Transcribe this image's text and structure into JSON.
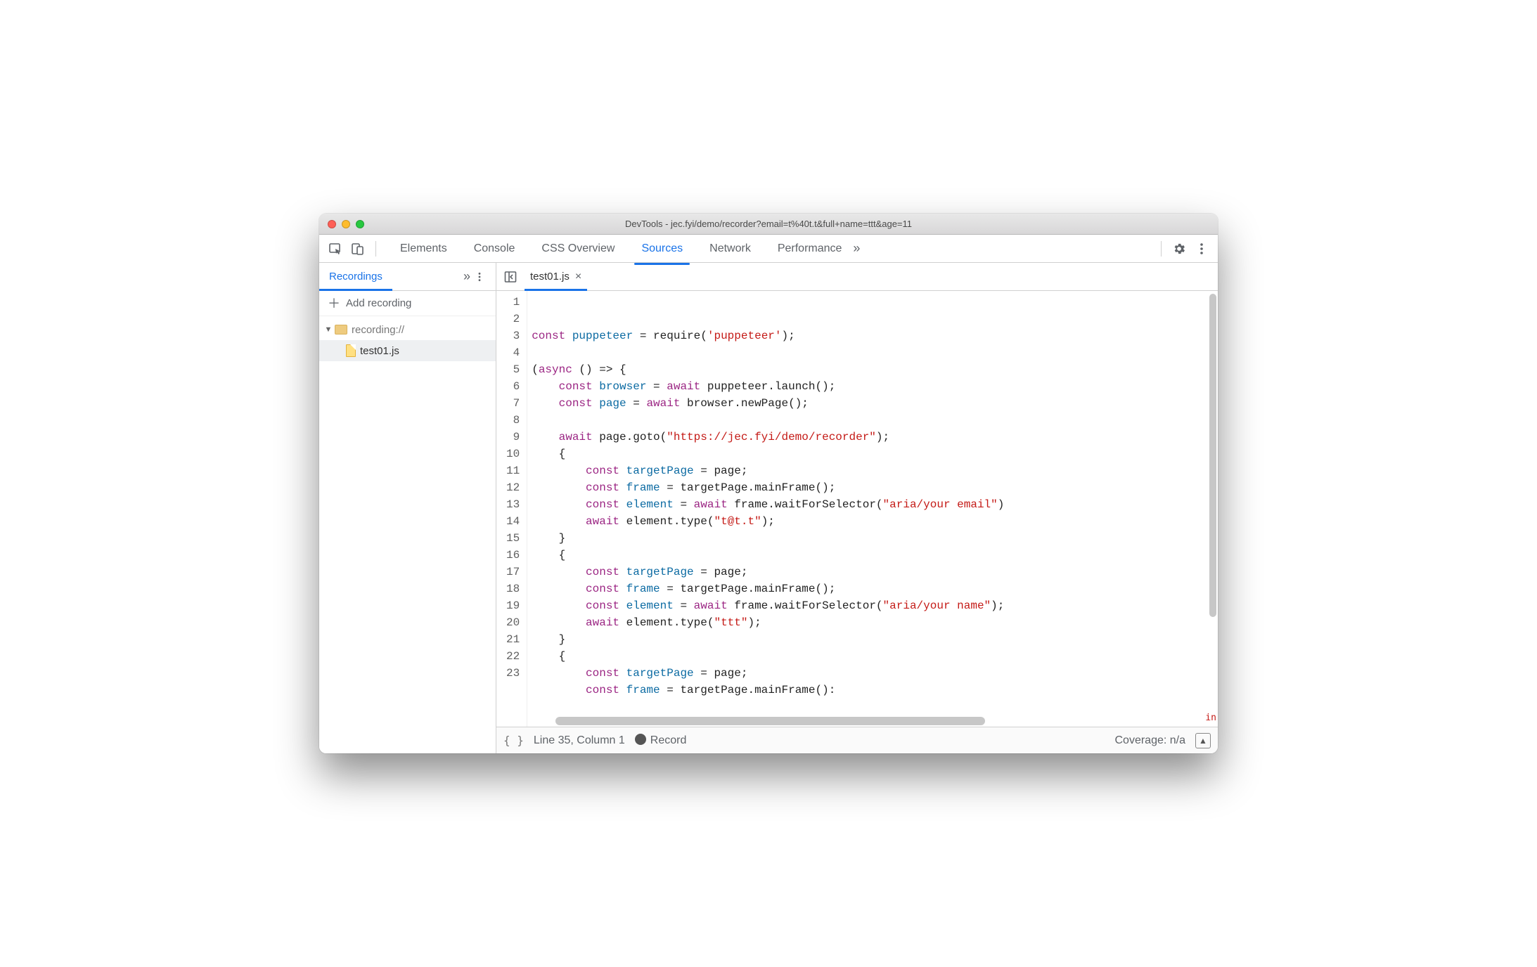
{
  "window": {
    "title": "DevTools - jec.fyi/demo/recorder?email=t%40t.t&full+name=ttt&age=11"
  },
  "main_tabs": {
    "items": [
      "Elements",
      "Console",
      "CSS Overview",
      "Sources",
      "Network",
      "Performance"
    ],
    "active_index": 3
  },
  "sidebar": {
    "tab_label": "Recordings",
    "add_label": "Add recording",
    "tree": {
      "root_label": "recording://",
      "file_label": "test01.js"
    }
  },
  "editor": {
    "tab_label": "test01.js",
    "gutter_start": 1,
    "gutter_end": 23,
    "truncated_hint": "in",
    "lines": [
      [
        {
          "t": "const ",
          "c": "kw"
        },
        {
          "t": "puppeteer",
          "c": "id"
        },
        {
          "t": " = ",
          "c": "pun"
        },
        {
          "t": "require",
          "c": "prop"
        },
        {
          "t": "(",
          "c": "pun"
        },
        {
          "t": "'puppeteer'",
          "c": "str"
        },
        {
          "t": ");",
          "c": "pun"
        }
      ],
      [],
      [
        {
          "t": "(",
          "c": "pun"
        },
        {
          "t": "async ",
          "c": "kw"
        },
        {
          "t": "() => {",
          "c": "pun"
        }
      ],
      [
        {
          "t": "    ",
          "c": "pun"
        },
        {
          "t": "const ",
          "c": "kw"
        },
        {
          "t": "browser",
          "c": "id"
        },
        {
          "t": " = ",
          "c": "pun"
        },
        {
          "t": "await ",
          "c": "kw"
        },
        {
          "t": "puppeteer",
          "c": "prop"
        },
        {
          "t": ".",
          "c": "pun"
        },
        {
          "t": "launch",
          "c": "prop"
        },
        {
          "t": "();",
          "c": "pun"
        }
      ],
      [
        {
          "t": "    ",
          "c": "pun"
        },
        {
          "t": "const ",
          "c": "kw"
        },
        {
          "t": "page",
          "c": "id"
        },
        {
          "t": " = ",
          "c": "pun"
        },
        {
          "t": "await ",
          "c": "kw"
        },
        {
          "t": "browser",
          "c": "prop"
        },
        {
          "t": ".",
          "c": "pun"
        },
        {
          "t": "newPage",
          "c": "prop"
        },
        {
          "t": "();",
          "c": "pun"
        }
      ],
      [],
      [
        {
          "t": "    ",
          "c": "pun"
        },
        {
          "t": "await ",
          "c": "kw"
        },
        {
          "t": "page",
          "c": "prop"
        },
        {
          "t": ".",
          "c": "pun"
        },
        {
          "t": "goto",
          "c": "prop"
        },
        {
          "t": "(",
          "c": "pun"
        },
        {
          "t": "\"https://jec.fyi/demo/recorder\"",
          "c": "str"
        },
        {
          "t": ");",
          "c": "pun"
        }
      ],
      [
        {
          "t": "    {",
          "c": "pun"
        }
      ],
      [
        {
          "t": "        ",
          "c": "pun"
        },
        {
          "t": "const ",
          "c": "kw"
        },
        {
          "t": "targetPage",
          "c": "id"
        },
        {
          "t": " = ",
          "c": "pun"
        },
        {
          "t": "page",
          "c": "prop"
        },
        {
          "t": ";",
          "c": "pun"
        }
      ],
      [
        {
          "t": "        ",
          "c": "pun"
        },
        {
          "t": "const ",
          "c": "kw"
        },
        {
          "t": "frame",
          "c": "id"
        },
        {
          "t": " = ",
          "c": "pun"
        },
        {
          "t": "targetPage",
          "c": "prop"
        },
        {
          "t": ".",
          "c": "pun"
        },
        {
          "t": "mainFrame",
          "c": "prop"
        },
        {
          "t": "();",
          "c": "pun"
        }
      ],
      [
        {
          "t": "        ",
          "c": "pun"
        },
        {
          "t": "const ",
          "c": "kw"
        },
        {
          "t": "element",
          "c": "id"
        },
        {
          "t": " = ",
          "c": "pun"
        },
        {
          "t": "await ",
          "c": "kw"
        },
        {
          "t": "frame",
          "c": "prop"
        },
        {
          "t": ".",
          "c": "pun"
        },
        {
          "t": "waitForSelector",
          "c": "prop"
        },
        {
          "t": "(",
          "c": "pun"
        },
        {
          "t": "\"aria/your email\"",
          "c": "str"
        },
        {
          "t": ")",
          "c": "pun"
        }
      ],
      [
        {
          "t": "        ",
          "c": "pun"
        },
        {
          "t": "await ",
          "c": "kw"
        },
        {
          "t": "element",
          "c": "prop"
        },
        {
          "t": ".",
          "c": "pun"
        },
        {
          "t": "type",
          "c": "prop"
        },
        {
          "t": "(",
          "c": "pun"
        },
        {
          "t": "\"t@t.t\"",
          "c": "str"
        },
        {
          "t": ");",
          "c": "pun"
        }
      ],
      [
        {
          "t": "    }",
          "c": "pun"
        }
      ],
      [
        {
          "t": "    {",
          "c": "pun"
        }
      ],
      [
        {
          "t": "        ",
          "c": "pun"
        },
        {
          "t": "const ",
          "c": "kw"
        },
        {
          "t": "targetPage",
          "c": "id"
        },
        {
          "t": " = ",
          "c": "pun"
        },
        {
          "t": "page",
          "c": "prop"
        },
        {
          "t": ";",
          "c": "pun"
        }
      ],
      [
        {
          "t": "        ",
          "c": "pun"
        },
        {
          "t": "const ",
          "c": "kw"
        },
        {
          "t": "frame",
          "c": "id"
        },
        {
          "t": " = ",
          "c": "pun"
        },
        {
          "t": "targetPage",
          "c": "prop"
        },
        {
          "t": ".",
          "c": "pun"
        },
        {
          "t": "mainFrame",
          "c": "prop"
        },
        {
          "t": "();",
          "c": "pun"
        }
      ],
      [
        {
          "t": "        ",
          "c": "pun"
        },
        {
          "t": "const ",
          "c": "kw"
        },
        {
          "t": "element",
          "c": "id"
        },
        {
          "t": " = ",
          "c": "pun"
        },
        {
          "t": "await ",
          "c": "kw"
        },
        {
          "t": "frame",
          "c": "prop"
        },
        {
          "t": ".",
          "c": "pun"
        },
        {
          "t": "waitForSelector",
          "c": "prop"
        },
        {
          "t": "(",
          "c": "pun"
        },
        {
          "t": "\"aria/your name\"",
          "c": "str"
        },
        {
          "t": ");",
          "c": "pun"
        }
      ],
      [
        {
          "t": "        ",
          "c": "pun"
        },
        {
          "t": "await ",
          "c": "kw"
        },
        {
          "t": "element",
          "c": "prop"
        },
        {
          "t": ".",
          "c": "pun"
        },
        {
          "t": "type",
          "c": "prop"
        },
        {
          "t": "(",
          "c": "pun"
        },
        {
          "t": "\"ttt\"",
          "c": "str"
        },
        {
          "t": ");",
          "c": "pun"
        }
      ],
      [
        {
          "t": "    }",
          "c": "pun"
        }
      ],
      [
        {
          "t": "    {",
          "c": "pun"
        }
      ],
      [
        {
          "t": "        ",
          "c": "pun"
        },
        {
          "t": "const ",
          "c": "kw"
        },
        {
          "t": "targetPage",
          "c": "id"
        },
        {
          "t": " = ",
          "c": "pun"
        },
        {
          "t": "page",
          "c": "prop"
        },
        {
          "t": ";",
          "c": "pun"
        }
      ],
      [
        {
          "t": "        ",
          "c": "pun"
        },
        {
          "t": "const ",
          "c": "kw"
        },
        {
          "t": "frame",
          "c": "id"
        },
        {
          "t": " = ",
          "c": "pun"
        },
        {
          "t": "targetPage",
          "c": "prop"
        },
        {
          "t": ".",
          "c": "pun"
        },
        {
          "t": "mainFrame",
          "c": "prop"
        },
        {
          "t": "():",
          "c": "pun"
        }
      ]
    ]
  },
  "statusbar": {
    "cursor": "Line 35, Column 1",
    "record": "Record",
    "coverage": "Coverage: n/a"
  }
}
